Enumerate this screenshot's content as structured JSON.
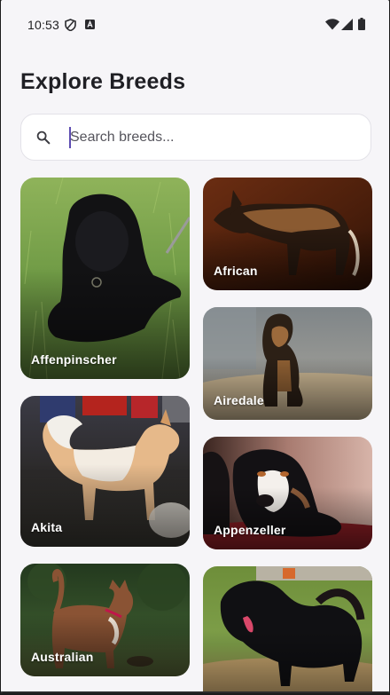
{
  "status_bar": {
    "time": "10:53"
  },
  "page": {
    "title": "Explore Breeds"
  },
  "search": {
    "placeholder": "Search breeds...",
    "value": ""
  },
  "breeds": [
    {
      "name": "Affenpinscher"
    },
    {
      "name": "African"
    },
    {
      "name": "Airedale"
    },
    {
      "name": "Akita"
    },
    {
      "name": "Appenzeller"
    },
    {
      "name": "Australian"
    },
    {
      "name": ""
    }
  ],
  "colors": {
    "background": "#f6f5f8",
    "title_text": "#1f1f24",
    "search_caret": "#5e4db2",
    "card_label": "#ffffff"
  }
}
